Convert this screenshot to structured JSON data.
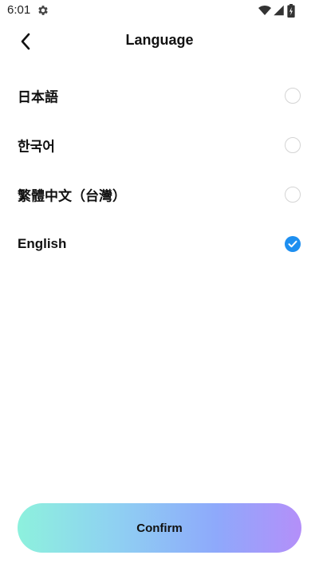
{
  "status_bar": {
    "time": "6:01",
    "icons": [
      "gear-icon",
      "wifi-icon",
      "signal-icon",
      "battery-icon"
    ]
  },
  "header": {
    "back_icon": "chevron-left-icon",
    "title": "Language"
  },
  "languages": [
    {
      "label": "日本語",
      "selected": false
    },
    {
      "label": "한국어",
      "selected": false
    },
    {
      "label": "繁體中文（台灣）",
      "selected": false
    },
    {
      "label": "English",
      "selected": true
    }
  ],
  "confirm": {
    "label": "Confirm"
  },
  "colors": {
    "accent": "#1e8ff0",
    "radio_border": "#d4d4d4",
    "gradient_start": "#8df1dd",
    "gradient_end": "#b48ff9"
  }
}
